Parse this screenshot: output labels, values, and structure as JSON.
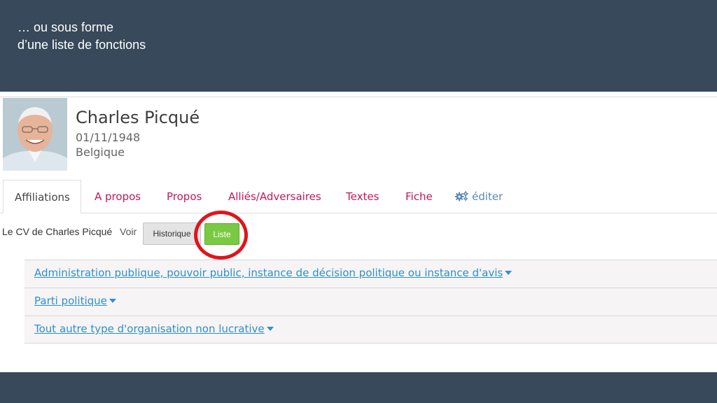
{
  "slide": {
    "caption_line1": "… ou sous forme",
    "caption_line2": "d’une liste de fonctions"
  },
  "colors": {
    "band": "#37495a",
    "tab_link": "#c2185b",
    "accordion_link": "#2f8fd0",
    "button_active": "#7ac943",
    "highlight": "#e1141b"
  },
  "profile": {
    "name": "Charles Picqué",
    "birth_date": "01/11/1948",
    "country": "Belgique",
    "avatar_icon": "person-photo"
  },
  "tabs": [
    {
      "label": "Affiliations",
      "active": true
    },
    {
      "label": "A propos"
    },
    {
      "label": "Propos"
    },
    {
      "label": "Alliés/Adversaires"
    },
    {
      "label": "Textes"
    },
    {
      "label": "Fiche"
    },
    {
      "label": "éditer",
      "icon": "gears-icon"
    }
  ],
  "cv": {
    "label": "Le CV de Charles Picqué",
    "voir_label": "Voir",
    "historique_button": "Historique",
    "liste_button": "Liste"
  },
  "affiliations": [
    {
      "label": "Administration publique, pouvoir public, instance de décision politique ou instance d'avis"
    },
    {
      "label": "Parti politique"
    },
    {
      "label": "Tout autre type d'organisation non lucrative"
    }
  ]
}
